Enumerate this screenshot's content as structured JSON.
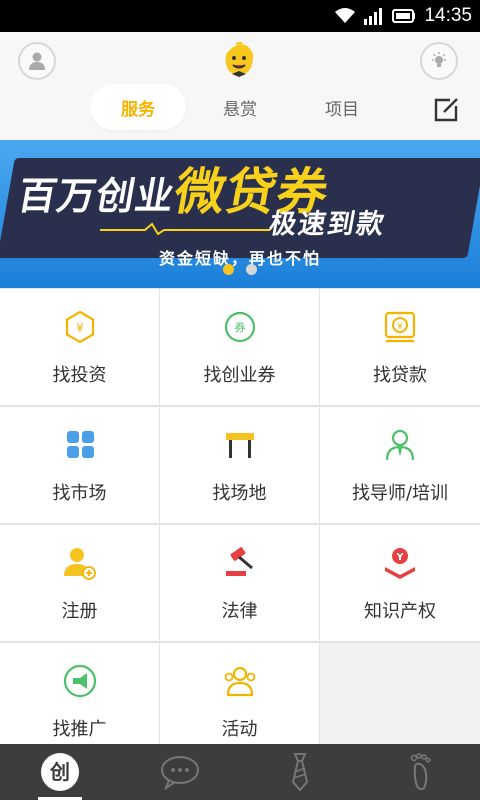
{
  "status_bar": {
    "time": "14:35",
    "icons": [
      "wifi-icon",
      "signal-icon",
      "battery-icon"
    ]
  },
  "header": {
    "left_button_icon": "user-icon",
    "logo_icon": "mascot-logo",
    "right_button_icon": "lightbulb-icon",
    "edit_icon": "edit-icon",
    "tabs": [
      {
        "label": "服务",
        "active": true
      },
      {
        "label": "悬赏",
        "active": false
      },
      {
        "label": "项目",
        "active": false
      }
    ]
  },
  "banner": {
    "title_small": "百万创业",
    "title_big": "微贷券",
    "subtitle": "极速到款",
    "slogan": "资金短缺，再也不怕",
    "page_count": 2,
    "active_page": 1
  },
  "colors": {
    "accent": "#f5b300",
    "green": "#4cc06a",
    "blue": "#4a9fe8",
    "red": "#e84040"
  },
  "services": [
    {
      "label": "找投资",
      "icon": "yuan-hexagon-icon"
    },
    {
      "label": "找创业券",
      "icon": "coupon-icon"
    },
    {
      "label": "找贷款",
      "icon": "loan-icon"
    },
    {
      "label": "找市场",
      "icon": "grid-squares-icon"
    },
    {
      "label": "找场地",
      "icon": "venue-table-icon"
    },
    {
      "label": "找导师/培训",
      "icon": "mentor-icon"
    },
    {
      "label": "注册",
      "icon": "register-user-icon"
    },
    {
      "label": "法律",
      "icon": "gavel-icon"
    },
    {
      "label": "知识产权",
      "icon": "ip-book-icon"
    },
    {
      "label": "找推广",
      "icon": "megaphone-icon"
    },
    {
      "label": "活动",
      "icon": "activity-people-icon"
    }
  ],
  "bottom_nav": [
    {
      "icon": "chuang-icon",
      "active": true
    },
    {
      "icon": "chat-icon",
      "active": false
    },
    {
      "icon": "tie-icon",
      "active": false
    },
    {
      "icon": "footprint-icon",
      "active": false
    }
  ]
}
